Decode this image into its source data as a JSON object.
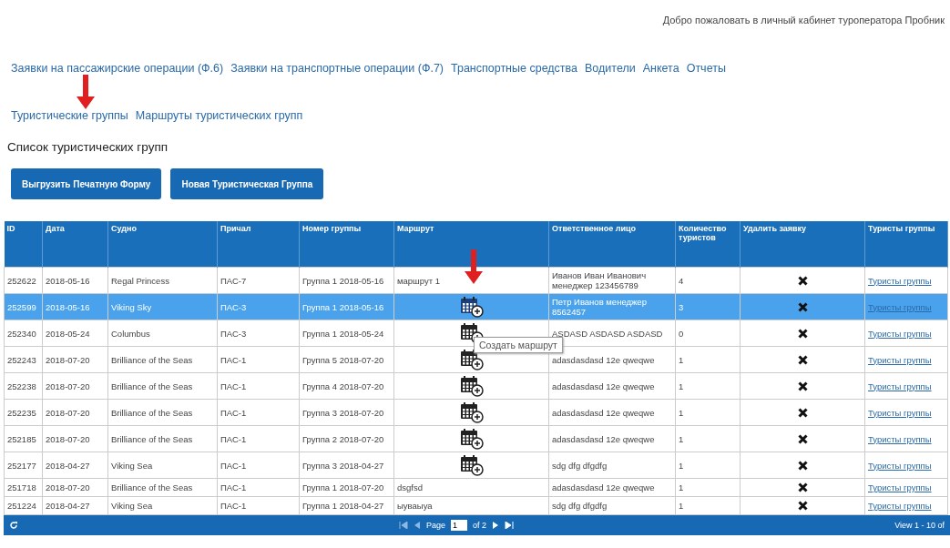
{
  "welcome": "Добро пожаловать в личный кабинет туроператора Пробник",
  "nav": [
    "Заявки на пассажирские операции (Ф.6)",
    "Заявки на транспортные операции (Ф.7)",
    "Транспортные средства",
    "Водители",
    "Анкета",
    "Отчеты"
  ],
  "subnav": [
    "Туристические группы",
    "Маршруты туристических групп"
  ],
  "heading": "Список туристических групп",
  "buttons": [
    "Выгрузить Печатную Форму",
    "Новая Туристическая Группа"
  ],
  "table": {
    "columns": [
      "ID",
      "Дата",
      "Судно",
      "Причал",
      "Номер группы",
      "Маршрут",
      "Ответственное лицо",
      "Количество туристов",
      "Удалить заявку",
      "Туристы группы"
    ],
    "rows": [
      {
        "id": "252622",
        "date": "2018-05-16",
        "ship": "Regal Princess",
        "berth": "ПАС-7",
        "group": "Группа 1 2018-05-16",
        "route": "маршрут 1",
        "create_route": false,
        "contact": "Иванов Иван Иванович менеджер 123456789",
        "count": "4",
        "link": "Туристы группы",
        "selected": false
      },
      {
        "id": "252599",
        "date": "2018-05-16",
        "ship": "Viking Sky",
        "berth": "ПАС-3",
        "group": "Группа 1 2018-05-16",
        "create_route": true,
        "contact": "Петр Иванов менеджер 8562457",
        "count": "3",
        "link": "Туристы группы",
        "selected": true
      },
      {
        "id": "252340",
        "date": "2018-05-24",
        "ship": "Columbus",
        "berth": "ПАС-3",
        "group": "Группа 1 2018-05-24",
        "create_route": true,
        "contact": "ASDASD ASDASD ASDASD",
        "count": "0",
        "link": "Туристы группы",
        "selected": false
      },
      {
        "id": "252243",
        "date": "2018-07-20",
        "ship": "Brilliance of the Seas",
        "berth": "ПАС-1",
        "group": "Группа 5 2018-07-20",
        "create_route": true,
        "contact": "adasdasdasd 12e qweqwe",
        "count": "1",
        "link": "Туристы группы",
        "selected": false
      },
      {
        "id": "252238",
        "date": "2018-07-20",
        "ship": "Brilliance of the Seas",
        "berth": "ПАС-1",
        "group": "Группа 4 2018-07-20",
        "create_route": true,
        "contact": "adasdasdasd 12e qweqwe",
        "count": "1",
        "link": "Туристы группы",
        "selected": false
      },
      {
        "id": "252235",
        "date": "2018-07-20",
        "ship": "Brilliance of the Seas",
        "berth": "ПАС-1",
        "group": "Группа 3 2018-07-20",
        "create_route": true,
        "contact": "adasdasdasd 12e qweqwe",
        "count": "1",
        "link": "Туристы группы",
        "selected": false
      },
      {
        "id": "252185",
        "date": "2018-07-20",
        "ship": "Brilliance of the Seas",
        "berth": "ПАС-1",
        "group": "Группа 2 2018-07-20",
        "create_route": true,
        "contact": "adasdasdasd 12e qweqwe",
        "count": "1",
        "link": "Туристы группы",
        "selected": false
      },
      {
        "id": "252177",
        "date": "2018-04-27",
        "ship": "Viking Sea",
        "berth": "ПАС-1",
        "group": "Группа 3 2018-04-27",
        "create_route": true,
        "contact": "sdg dfg dfgdfg",
        "count": "1",
        "link": "Туристы группы",
        "selected": false
      },
      {
        "id": "251718",
        "date": "2018-07-20",
        "ship": "Brilliance of the Seas",
        "berth": "ПАС-1",
        "group": "Группа 1 2018-07-20",
        "route": "dsgfsd",
        "create_route": false,
        "contact": "adasdasdasd 12e qweqwe",
        "count": "1",
        "link": "Туристы группы",
        "selected": false
      },
      {
        "id": "251224",
        "date": "2018-04-27",
        "ship": "Viking Sea",
        "berth": "ПАС-1",
        "group": "Группа 1 2018-04-27",
        "route": "ыуваыуа",
        "create_route": false,
        "contact": "sdg dfg dfgdfg",
        "count": "1",
        "link": "Туристы группы",
        "selected": false
      }
    ]
  },
  "tooltip": "Создать маршрут",
  "pager": {
    "page_label": "Page",
    "page": "1",
    "of": "of 2",
    "view": "View 1 - 10 of"
  }
}
